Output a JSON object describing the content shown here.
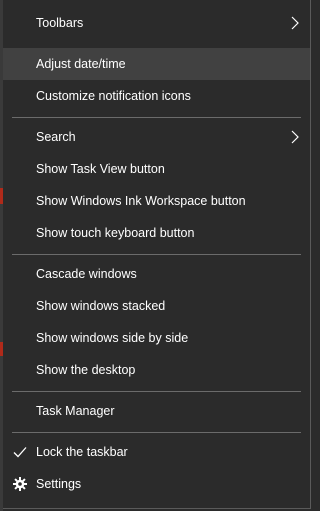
{
  "context_menu": {
    "items": [
      {
        "label": "Toolbars",
        "submenu": true
      },
      {
        "label": "Adjust date/time",
        "highlighted": true
      },
      {
        "label": "Customize notification icons"
      },
      {
        "label": "Search",
        "submenu": true
      },
      {
        "label": "Show Task View button"
      },
      {
        "label": "Show Windows Ink Workspace button"
      },
      {
        "label": "Show touch keyboard button"
      },
      {
        "label": "Cascade windows"
      },
      {
        "label": "Show windows stacked"
      },
      {
        "label": "Show windows side by side"
      },
      {
        "label": "Show the desktop"
      },
      {
        "label": "Task Manager"
      },
      {
        "label": "Lock the taskbar",
        "icon": "checkmark-icon",
        "checked": true
      },
      {
        "label": "Settings",
        "icon": "gear-icon"
      }
    ]
  },
  "colors": {
    "background": "#2b2b2b",
    "highlight": "#414141",
    "text": "#ffffff",
    "separator": "#6b6b6b"
  }
}
